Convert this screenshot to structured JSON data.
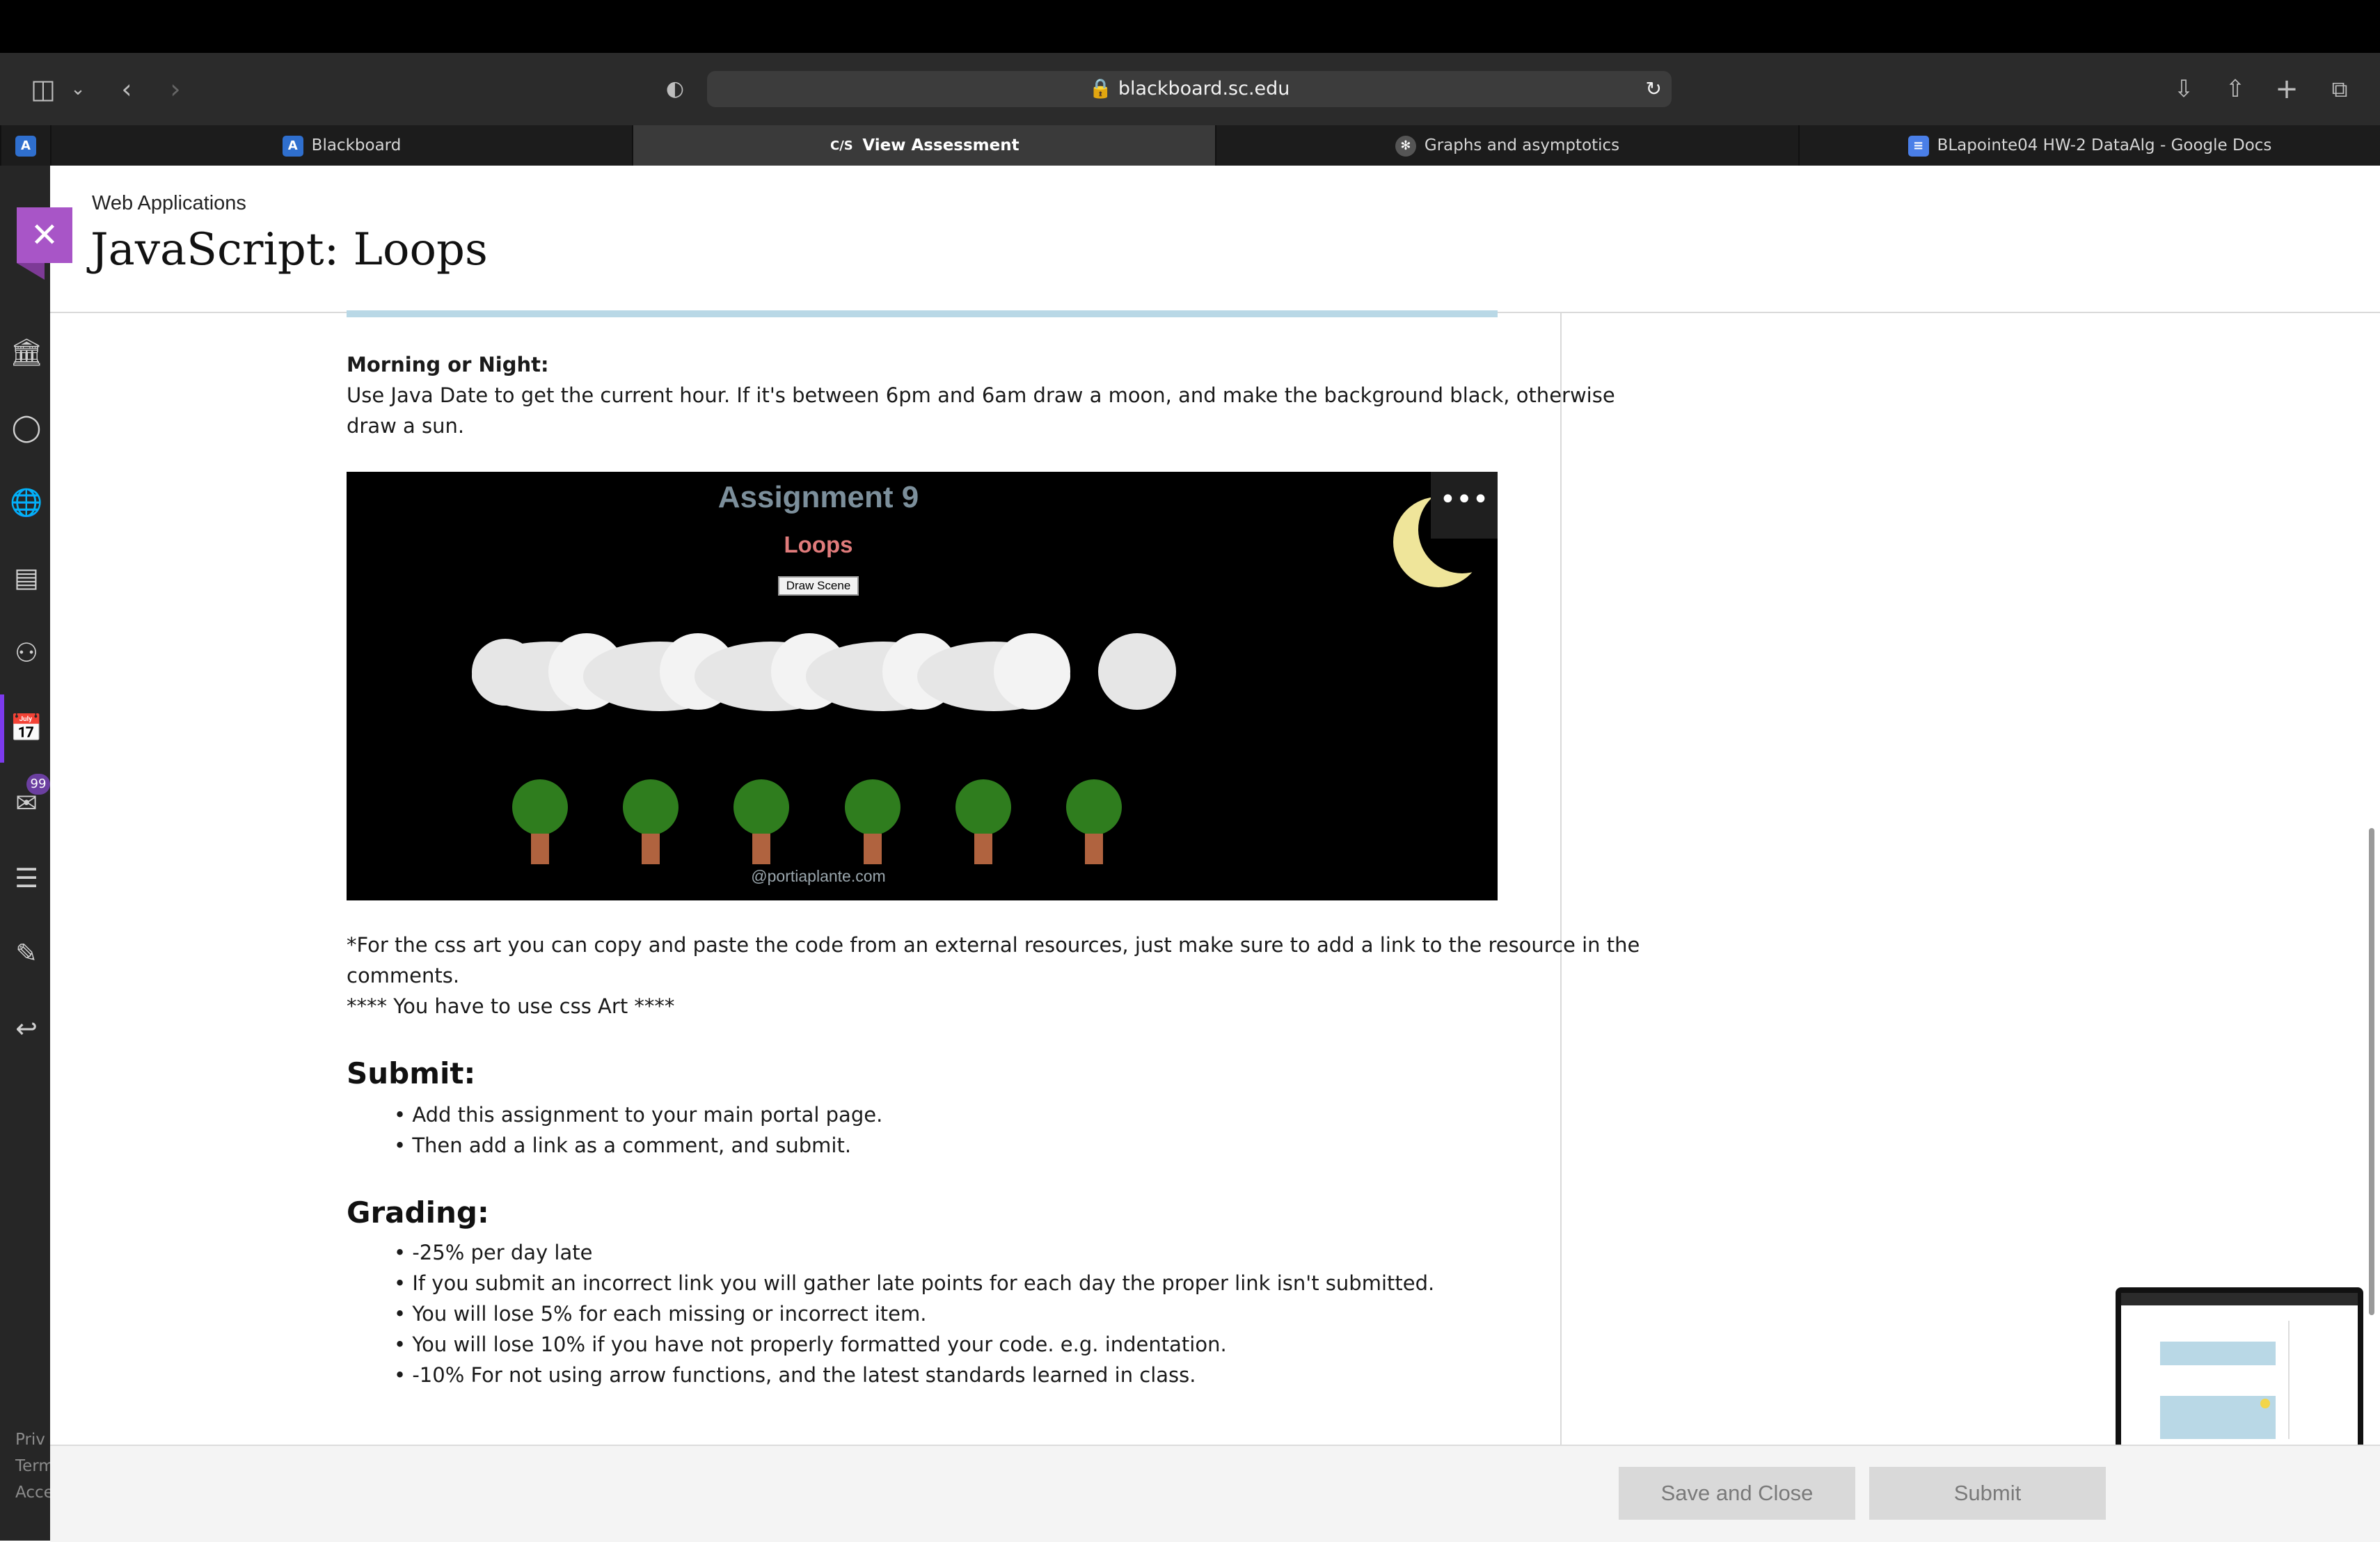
{
  "browser": {
    "url": "blackboard.sc.edu",
    "tabs": [
      {
        "label": "Blackboard"
      },
      {
        "label": "View Assessment"
      },
      {
        "label": "Graphs and asymptotics"
      },
      {
        "label": "BLapointe04 HW-2 DataAlg - Google Docs"
      }
    ]
  },
  "panel": {
    "breadcrumb": "Web Applications",
    "title": "JavaScript: Loops"
  },
  "nav": {
    "mail_badge": "99",
    "footer_links": [
      "Priv",
      "Term",
      "Acce"
    ]
  },
  "content": {
    "morning_heading": "Morning or Night:",
    "morning_text_1": "Use Java Date to get the current hour. If it's between 6pm and 6am draw a moon, and make the background black, otherwise",
    "morning_text_2": "draw a sun.",
    "embed": {
      "title": "Assignment 9",
      "subtitle": "Loops",
      "button": "Draw Scene",
      "credit": "@portiaplante.com",
      "more_label": "•••"
    },
    "css_note_1": "*For the css art you can copy and paste the code from an external resources, just make sure to add a link to the resource in the",
    "css_note_2": "comments.",
    "css_note_3": "**** You have to use css Art ****",
    "submit_heading": "Submit:",
    "submit_items": [
      "• Add this assignment to your main portal page.",
      "• Then add a link as a comment, and submit."
    ],
    "grading_heading": "Grading:",
    "grading_items": [
      "• -25% per day late",
      "• If you submit an incorrect link you will gather late points for each day the proper link isn't submitted.",
      "• You will lose 5% for each missing or incorrect item.",
      "• You will lose 10% if you have not properly formatted your code. e.g. indentation.",
      "• -10% For not using arrow functions, and the latest standards learned in class."
    ]
  },
  "footer": {
    "save_close": "Save and Close",
    "submit": "Submit"
  }
}
